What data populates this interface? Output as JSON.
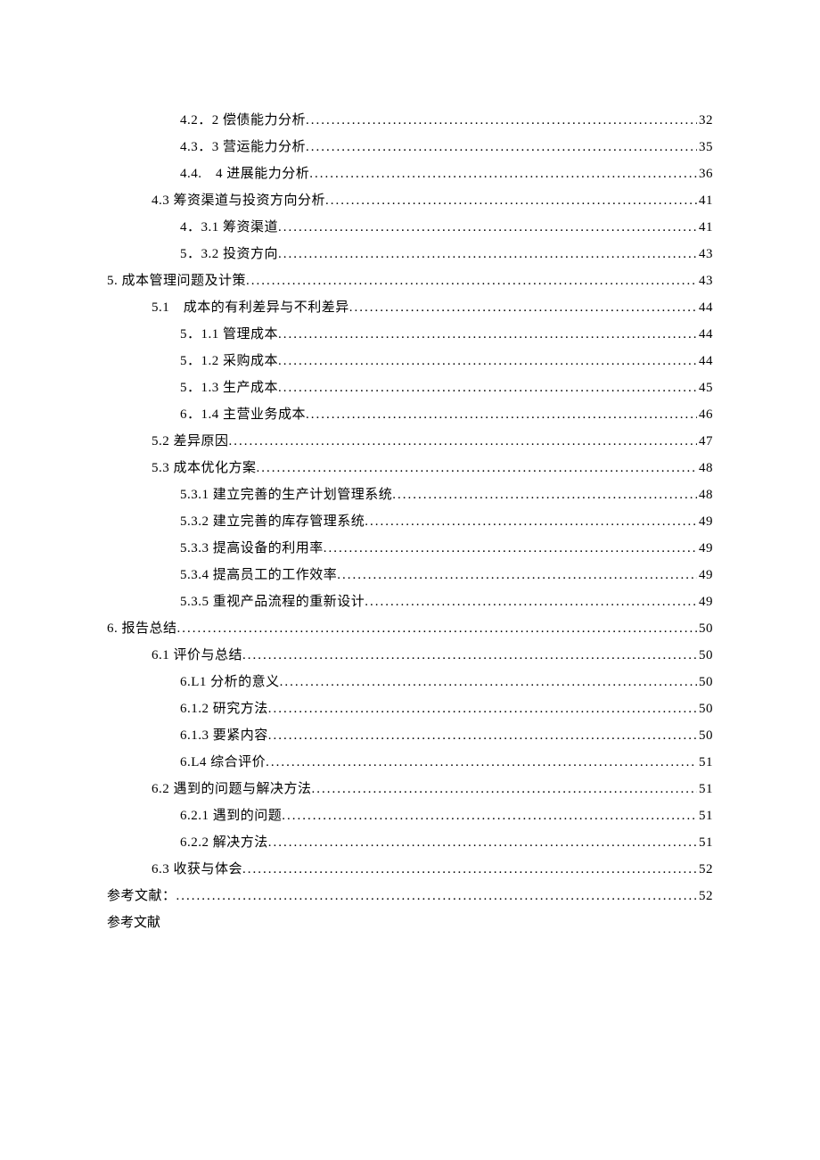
{
  "toc": [
    {
      "indent": 2,
      "label": "4.2．2 偿债能力分析",
      "page": "32"
    },
    {
      "indent": 2,
      "label": "4.3．3 营运能力分析",
      "page": "35"
    },
    {
      "indent": 2,
      "label": "4.4.　4 进展能力分析",
      "page": "36"
    },
    {
      "indent": 1,
      "label": "4.3 筹资渠道与投资方向分析",
      "page": "41"
    },
    {
      "indent": 2,
      "label": "4．3.1 筹资渠道",
      "page": "41"
    },
    {
      "indent": 2,
      "label": "5．3.2 投资方向",
      "page": "43"
    },
    {
      "indent": 0,
      "label": "5. 成本管理问题及计策",
      "page": "43"
    },
    {
      "indent": 1,
      "label": "5.1　成本的有利差异与不利差异",
      "page": "44"
    },
    {
      "indent": 2,
      "label": "5．1.1 管理成本",
      "page": "44"
    },
    {
      "indent": 2,
      "label": "5．1.2 采购成本",
      "page": "44"
    },
    {
      "indent": 2,
      "label": "5．1.3 生产成本",
      "page": "45"
    },
    {
      "indent": 2,
      "label": "6．1.4 主营业务成本",
      "page": "46"
    },
    {
      "indent": 1,
      "label": "5.2 差异原因",
      "page": "47"
    },
    {
      "indent": 1,
      "label": "5.3 成本优化方案",
      "page": "48"
    },
    {
      "indent": 2,
      "label": "5.3.1 建立完善的生产计划管理系统",
      "page": "48"
    },
    {
      "indent": 2,
      "label": "5.3.2 建立完善的库存管理系统",
      "page": "49"
    },
    {
      "indent": 2,
      "label": "5.3.3 提高设备的利用率",
      "page": "49"
    },
    {
      "indent": 2,
      "label": "5.3.4 提高员工的工作效率",
      "page": "49"
    },
    {
      "indent": 2,
      "label": "5.3.5 重视产品流程的重新设计",
      "page": "49"
    },
    {
      "indent": 0,
      "label": "6. 报告总结",
      "page": "50"
    },
    {
      "indent": 1,
      "label": "6.1 评价与总结",
      "page": "50"
    },
    {
      "indent": 2,
      "label": "6.L1 分析的意义",
      "page": "50"
    },
    {
      "indent": 2,
      "label": "6.1.2 研究方法",
      "page": "50"
    },
    {
      "indent": 2,
      "label": "6.1.3 要紧内容",
      "page": "50"
    },
    {
      "indent": 2,
      "label": "6.L4 综合评价",
      "page": "51"
    },
    {
      "indent": 1,
      "label": "6.2 遇到的问题与解决方法",
      "page": "51"
    },
    {
      "indent": 2,
      "label": "6.2.1 遇到的问题",
      "page": "51"
    },
    {
      "indent": 2,
      "label": "6.2.2 解决方法",
      "page": "51"
    },
    {
      "indent": 1,
      "label": "6.3 收获与体会",
      "page": "52"
    },
    {
      "indent": 0,
      "label": "参考文献：",
      "page": "52"
    }
  ],
  "final_line": "参考文献"
}
